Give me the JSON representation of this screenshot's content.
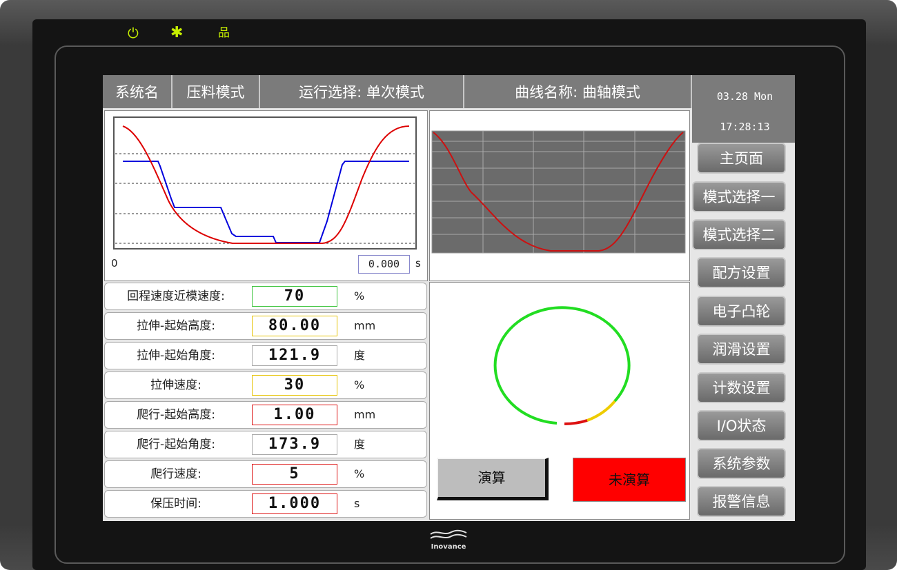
{
  "header": {
    "system_name": "系统名",
    "mode": "压料模式",
    "run_select": "运行选择:  单次模式",
    "curve_name": "曲线名称:  曲轴模式",
    "date": "03.28 Mon",
    "time": "17:28:13"
  },
  "left_chart": {
    "origin_label": "0",
    "time_value": "0.000",
    "time_unit": "s",
    "red_color": "#dd0000",
    "blue_color": "#0000dd"
  },
  "params": [
    {
      "label": "回程速度近模速度:",
      "value": "70",
      "unit": "%",
      "border": "#3ec43e"
    },
    {
      "label": "拉伸-起始高度:",
      "value": "80.00",
      "unit": "mm",
      "border": "#e6c200"
    },
    {
      "label": "拉伸-起始角度:",
      "value": "121.9",
      "unit": "度",
      "border": "#aaaaaa"
    },
    {
      "label": "拉伸速度:",
      "value": "30",
      "unit": "%",
      "border": "#e6c200"
    },
    {
      "label": "爬行-起始高度:",
      "value": "1.00",
      "unit": "mm",
      "border": "#d11"
    },
    {
      "label": "爬行-起始角度:",
      "value": "173.9",
      "unit": "度",
      "border": "#aaaaaa"
    },
    {
      "label": "爬行速度:",
      "value": "5",
      "unit": "%",
      "border": "#d11"
    },
    {
      "label": "保压时间:",
      "value": "1.000",
      "unit": "s",
      "border": "#d11"
    }
  ],
  "actions": {
    "calc_label": "演算",
    "status_label": "未演算",
    "status_color": "#ff0000"
  },
  "nav": [
    "主页面",
    "模式选择一",
    "模式选择二",
    "配方设置",
    "电子凸轮",
    "润滑设置",
    "计数设置",
    "I/O状态",
    "系统参数",
    "报警信息"
  ],
  "brand": "Inovance",
  "leds": [
    "power-icon",
    "star-icon",
    "network-icon"
  ]
}
